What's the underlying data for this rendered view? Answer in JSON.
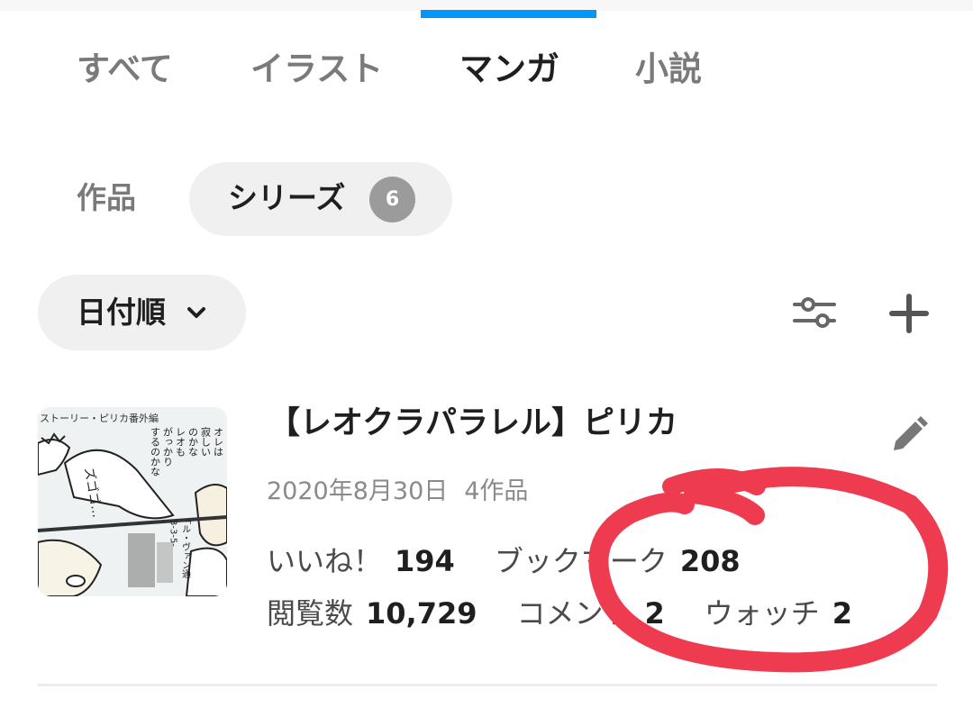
{
  "tabs": [
    {
      "label": "すべて",
      "active": false
    },
    {
      "label": "イラスト",
      "active": false
    },
    {
      "label": "マンガ",
      "active": true
    },
    {
      "label": "小説",
      "active": false
    }
  ],
  "subtabs": {
    "works_label": "作品",
    "series_label": "シリーズ",
    "series_count": "6"
  },
  "toolbar": {
    "sort_label": "日付順",
    "sort_icon": "chevron-down-icon",
    "filter_icon": "sliders-icon",
    "add_icon": "plus-icon"
  },
  "series": {
    "title": "【レオクラパラレル】ピリカ",
    "date": "2020年8月30日",
    "work_count": "4作品",
    "edit_icon": "pencil-icon",
    "thumbnail": {
      "caption": "ストーリー・ピリカ番外編",
      "lines": [
        "オレは",
        "寂しい",
        "のかな",
        "レオも",
        "がっかり",
        "するのかな"
      ],
      "sfx": "ズゴゴ…",
      "panel_text": "「ル・ヴァン通",
      "panel_num": "3-3-5-"
    },
    "stats": {
      "likes_label": "いいね！",
      "likes_value": "194",
      "bookmarks_label": "ブックマーク",
      "bookmarks_value": "208",
      "views_label": "閲覧数",
      "views_value": "10,729",
      "comments_label": "コメント",
      "comments_value": "2",
      "watch_label": "ウォッチ",
      "watch_value": "2"
    }
  },
  "colors": {
    "accent": "#0096fa",
    "annotation": "#ee3b4f",
    "badge": "#9b9b9b",
    "chip_bg": "#f0f0f0"
  }
}
